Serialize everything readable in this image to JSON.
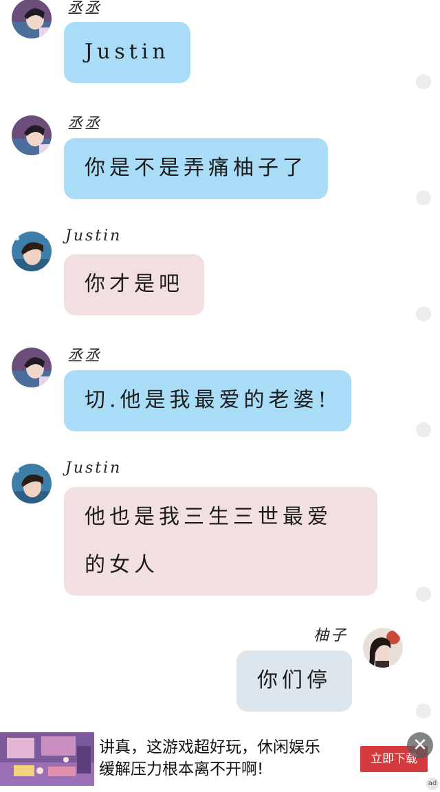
{
  "messages": [
    {
      "sender": "丞丞",
      "text": "Justin",
      "color": "#a9dcf6",
      "avatar": "avatar-chengcheng-icon"
    },
    {
      "sender": "丞丞",
      "text": "你是不是弄痛柚子了",
      "color": "#a9dcf6",
      "avatar": "avatar-chengcheng-icon"
    },
    {
      "sender": "Justin",
      "text": "你才是吧",
      "color": "#f2dfdf",
      "avatar": "avatar-justin-icon"
    },
    {
      "sender": "丞丞",
      "text": "切.他是我最爱的老婆!",
      "color": "#a9dcf6",
      "avatar": "avatar-chengcheng-icon"
    },
    {
      "sender": "Justin",
      "text_line1": "他也是我三生三世最爱",
      "text_line2": "的女人",
      "color": "#f2dfdf",
      "avatar": "avatar-justin-icon"
    },
    {
      "sender": "柚子",
      "text": "你们停",
      "color": "#dde5ed",
      "avatar": "avatar-youzi-icon"
    }
  ],
  "ad": {
    "line1": "讲真，这游戏超好玩，休闲娱乐",
    "line2": "缓解压力根本离不开啊!",
    "button": "立即下载",
    "close": "✕",
    "mark": "ad"
  }
}
